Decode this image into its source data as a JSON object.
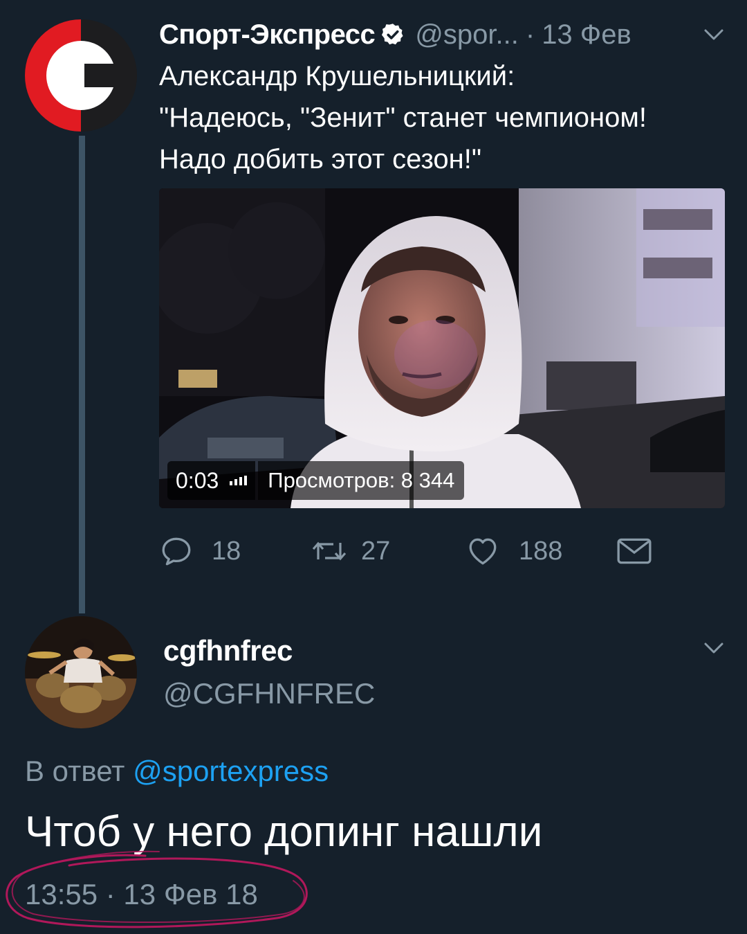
{
  "tweet": {
    "author_name": "Спорт-Экспресс",
    "handle": "@spor...",
    "separator": "·",
    "date": "13 Фев",
    "text_lines": [
      "Александр Крушельницкий:",
      "\"Надеюсь, \"Зенит\" станет чемпионом!",
      "Надо добить этот сезон!\""
    ],
    "video": {
      "time": "0:03",
      "views": "Просмотров: 8 344"
    },
    "actions": {
      "replies": "18",
      "retweets": "27",
      "likes": "188"
    }
  },
  "reply": {
    "author_name": "cgfhnfrec",
    "handle": "@CGFHNFREC",
    "reply_to_prefix": "В ответ",
    "reply_to_mention": "@sportexpress",
    "text": "Чтоб у него допинг нашли",
    "timestamp": "13:55 · 13 Фев 18"
  },
  "colors": {
    "background": "#15202b",
    "secondary_text": "#8899a6",
    "link": "#1da1f2",
    "annotation": "#b0185a"
  },
  "icons": [
    "verified-badge-icon",
    "chevron-down-icon",
    "reply-icon",
    "retweet-icon",
    "like-icon",
    "dm-icon"
  ]
}
